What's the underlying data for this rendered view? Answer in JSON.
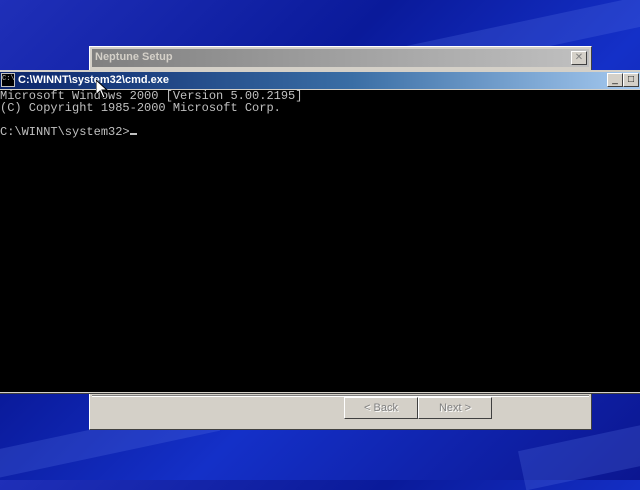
{
  "setup_dialog": {
    "title": "Neptune Setup",
    "close_glyph": "✕",
    "back_label": "< Back",
    "next_label": "Next >"
  },
  "cmd_window": {
    "title": "C:\\WINNT\\system32\\cmd.exe",
    "icon_text": "C:\\",
    "minimize_glyph": "_",
    "maximize_glyph": "□",
    "lines": [
      "Microsoft Windows 2000 [Version 5.00.2195]",
      "(C) Copyright 1985-2000 Microsoft Corp.",
      "",
      "C:\\WINNT\\system32>"
    ]
  },
  "colors": {
    "desktop": "#1430c8",
    "cmd_title_start": "#0a246a",
    "cmd_title_end": "#a6caf0",
    "console_bg": "#000000",
    "console_fg": "#c0c0c0"
  },
  "icons": [
    "cmd-icon",
    "close-icon",
    "minimize-icon",
    "maximize-icon",
    "mouse-pointer-icon"
  ]
}
